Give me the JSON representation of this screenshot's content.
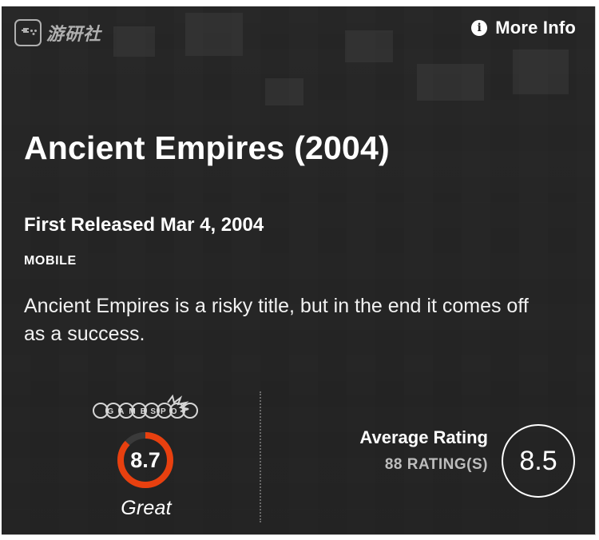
{
  "watermark": {
    "text": "游研社"
  },
  "header": {
    "more_info_label": "More Info",
    "info_icon_glyph": "i"
  },
  "game": {
    "title": "Ancient Empires (2004)",
    "first_released": "First Released Mar 4, 2004",
    "platform": "MOBILE",
    "description": "Ancient Empires is a risky title, but in the end it comes off as a success."
  },
  "gamespot": {
    "logo_text": "GAMESPOT",
    "score": "8.7",
    "score_fraction": 0.87,
    "verdict": "Great",
    "ring_color": "#e8400f"
  },
  "user_rating": {
    "title": "Average Rating",
    "count_label": "88 RATING(S)",
    "value": "8.5"
  }
}
